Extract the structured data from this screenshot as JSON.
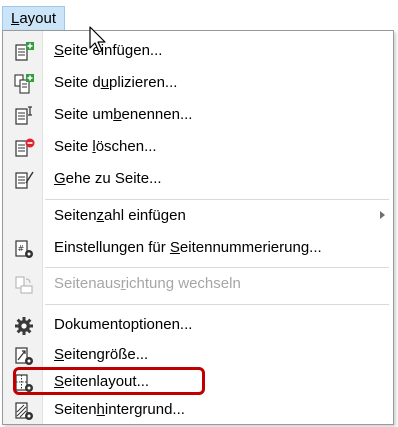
{
  "menubar": {
    "title": {
      "accel": "L",
      "rest": "ayout"
    }
  },
  "menu": {
    "items": [
      {
        "id": "seite-einfuegen",
        "pre": "",
        "accel": "S",
        "post": "eite einfügen...",
        "icon": "page-add-icon",
        "disabled": false
      },
      {
        "id": "seite-duplizieren",
        "pre": "Seite d",
        "accel": "u",
        "post": "plizieren...",
        "icon": "page-duplicate-icon",
        "disabled": false
      },
      {
        "id": "seite-umbenennen",
        "pre": "Seite um",
        "accel": "b",
        "post": "enennen...",
        "icon": "page-rename-icon",
        "disabled": false
      },
      {
        "id": "seite-loeschen",
        "pre": "Seite ",
        "accel": "l",
        "post": "öschen...",
        "icon": "page-delete-icon",
        "disabled": false
      },
      {
        "id": "gehe-zu-seite",
        "pre": "",
        "accel": "G",
        "post": "ehe zu Seite...",
        "icon": "page-goto-icon",
        "disabled": false
      },
      {
        "id": "seitenzahl-einfuegen",
        "pre": "Seiten",
        "accel": "z",
        "post": "ahl einfügen",
        "icon": "",
        "disabled": false,
        "submenu": true
      },
      {
        "id": "einstellungen-seitennummerierung",
        "pre": "Einstellungen für ",
        "accel": "S",
        "post": "eitennummerierung...",
        "icon": "page-number-settings-icon",
        "disabled": false
      },
      {
        "id": "seitenausrichtung-wechseln",
        "pre": "Seitenaus",
        "accel": "r",
        "post": "ichtung wechseln",
        "icon": "page-orientation-icon",
        "disabled": true
      },
      {
        "id": "dokumentoptionen",
        "pre": "Dokumentoptionen...",
        "accel": "",
        "post": "",
        "icon": "gear-icon",
        "disabled": false
      },
      {
        "id": "seitengroesse",
        "pre": "",
        "accel": "S",
        "post": "eitengröße...",
        "icon": "page-size-icon",
        "disabled": false
      },
      {
        "id": "seitenlayout",
        "pre": "",
        "accel": "S",
        "post": "eitenlayout...",
        "icon": "page-layout-icon",
        "disabled": false
      },
      {
        "id": "seitenhintergrund",
        "pre": "Seiten",
        "accel": "h",
        "post": "intergrund...",
        "icon": "page-background-icon",
        "disabled": false
      }
    ]
  },
  "colors": {
    "menu_highlight": "#cce4f7",
    "annotation_red": "#c00000",
    "icon_green": "#2e9e3e",
    "icon_red": "#e0202a",
    "disabled_text": "#a6a6a6"
  }
}
